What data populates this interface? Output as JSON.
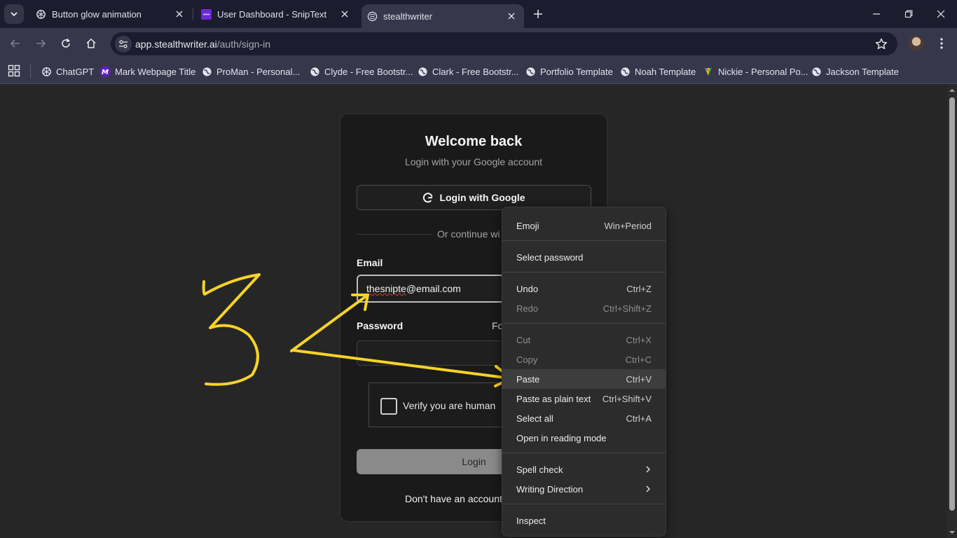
{
  "browser": {
    "tabs": [
      {
        "title": "Button glow animation",
        "icon": "openai-icon"
      },
      {
        "title": "User Dashboard - SnipText",
        "icon": "sniptext-icon"
      },
      {
        "title": "stealthwriter",
        "icon": "stealthwriter-icon",
        "active": true
      }
    ],
    "url_host": "app.stealthwriter.ai",
    "url_path": "/auth/sign-in",
    "bookmarks": [
      {
        "label": "ChatGPT",
        "icon": "openai-icon"
      },
      {
        "label": "Mark Webpage Title",
        "icon": "m-logo-icon"
      },
      {
        "label": "ProMan - Personal...",
        "icon": "globe-icon"
      },
      {
        "label": "Clyde - Free Bootstr...",
        "icon": "globe-icon"
      },
      {
        "label": "Clark - Free Bootstr...",
        "icon": "globe-icon"
      },
      {
        "label": "Portfolio Template",
        "icon": "globe-icon"
      },
      {
        "label": "Noah Template",
        "icon": "globe-icon"
      },
      {
        "label": "Nickie - Personal Po...",
        "icon": "leaf-icon"
      },
      {
        "label": "Jackson Template",
        "icon": "globe-icon"
      }
    ]
  },
  "login": {
    "title": "Welcome back",
    "subtitle": "Login with your Google account",
    "google_button": "Login with Google",
    "divider": "Or continue wi",
    "email_label": "Email",
    "email_value_prefix": "thesnipte",
    "email_value_suffix": "@email.com",
    "password_label": "Password",
    "forgot_partial": "Fo",
    "captcha_label": "Verify you are human",
    "login_button": "Login",
    "signup_prompt": "Don't have an account"
  },
  "context_menu": {
    "items": [
      {
        "label": "Emoji",
        "shortcut": "Win+Period"
      },
      {
        "label": "Select password",
        "shortcut": ""
      },
      {
        "label": "Undo",
        "shortcut": "Ctrl+Z"
      },
      {
        "label": "Redo",
        "shortcut": "Ctrl+Shift+Z",
        "disabled": true
      },
      {
        "label": "Cut",
        "shortcut": "Ctrl+X",
        "disabled": true
      },
      {
        "label": "Copy",
        "shortcut": "Ctrl+C",
        "disabled": true
      },
      {
        "label": "Paste",
        "shortcut": "Ctrl+V",
        "highlighted": true
      },
      {
        "label": "Paste as plain text",
        "shortcut": "Ctrl+Shift+V"
      },
      {
        "label": "Select all",
        "shortcut": "Ctrl+A"
      },
      {
        "label": "Open in reading mode",
        "shortcut": ""
      },
      {
        "label": "Spell check",
        "shortcut": ""
      },
      {
        "label": "Writing Direction",
        "shortcut": ""
      },
      {
        "label": "Inspect",
        "shortcut": ""
      }
    ]
  },
  "annotation": {
    "step_number": "3",
    "color": "#f5d328"
  }
}
